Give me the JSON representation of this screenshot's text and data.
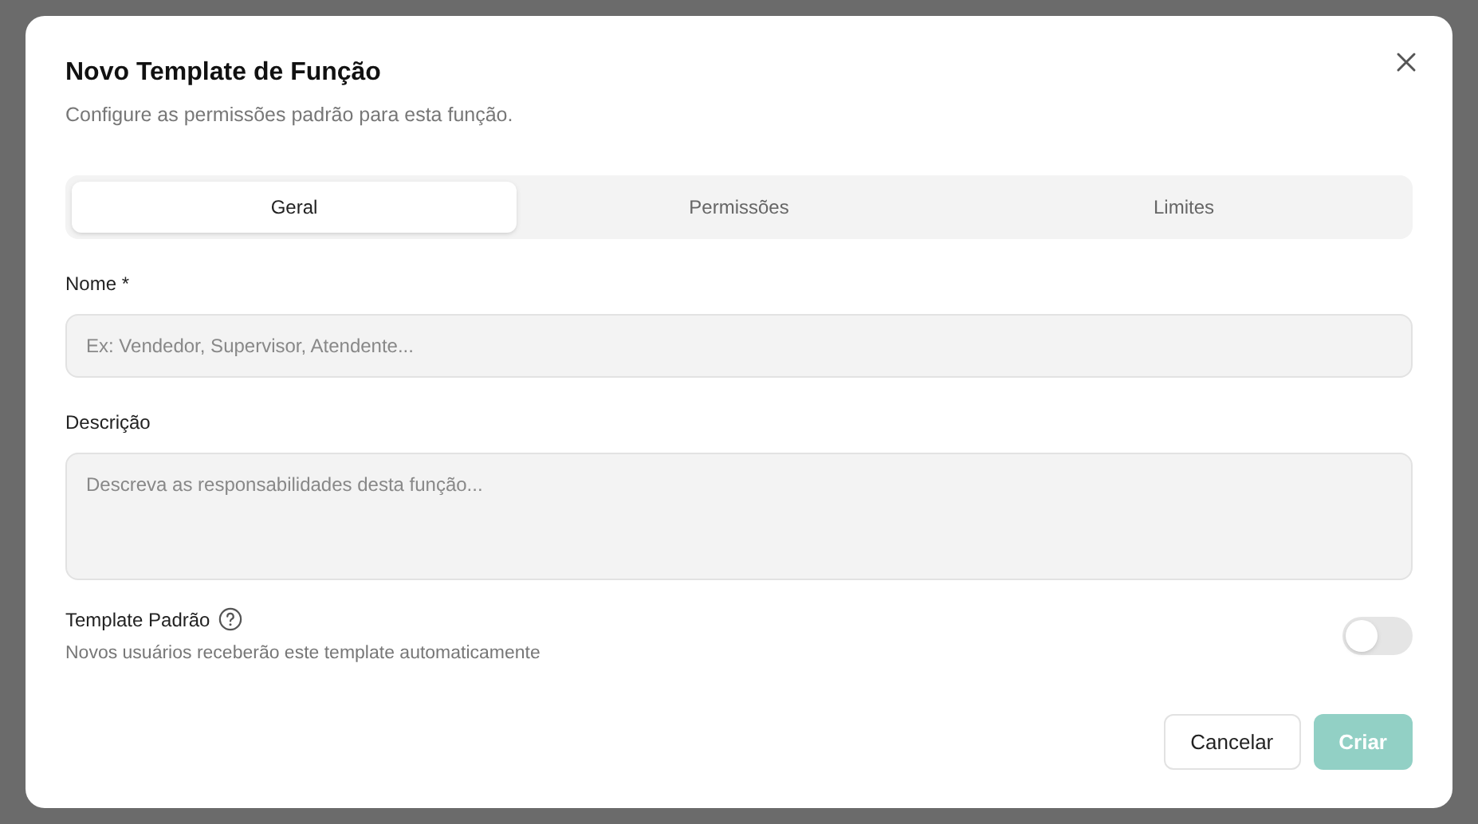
{
  "dialog": {
    "title": "Novo Template de Função",
    "subtitle": "Configure as permissões padrão para esta função."
  },
  "tabs": [
    {
      "label": "Geral",
      "selected": true
    },
    {
      "label": "Permissões",
      "selected": false
    },
    {
      "label": "Limites",
      "selected": false
    }
  ],
  "fields": [
    {
      "kind": "input",
      "label": "Nome *",
      "placeholder": "Ex: Vendedor, Supervisor, Atendente..."
    },
    {
      "kind": "textarea",
      "label": "Descrição",
      "placeholder": "Descreva as responsabilidades desta função..."
    }
  ],
  "default_template": {
    "label": "Template Padrão",
    "description": "Novos usuários receberão este template automaticamente",
    "on": false
  },
  "buttons": [
    {
      "label": "Cancelar",
      "kind": "secondary",
      "disabled": false
    },
    {
      "label": "Criar",
      "kind": "primary",
      "disabled": true
    }
  ]
}
